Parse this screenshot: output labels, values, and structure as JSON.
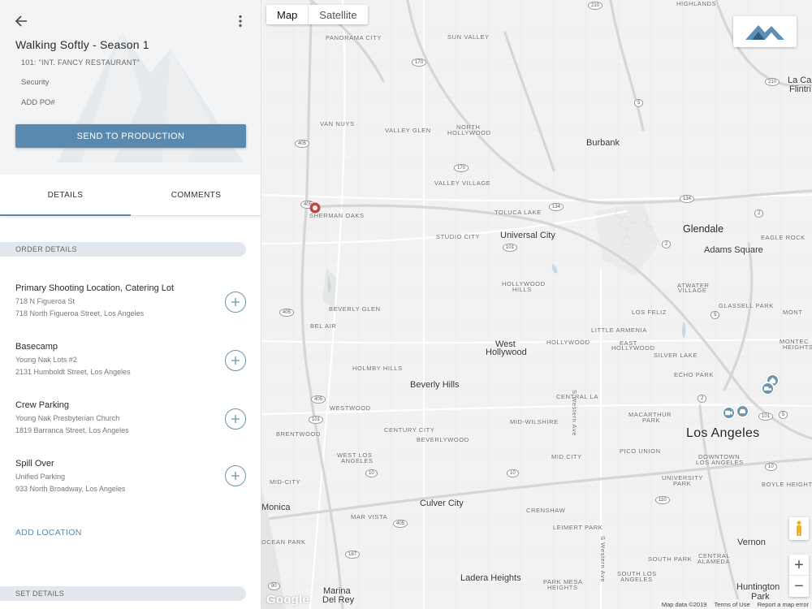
{
  "project": {
    "title": "Walking Softly - Season 1",
    "scene": "101: \"INT. FANCY RESTAURANT\"",
    "security": "Security",
    "add_po": "ADD PO#",
    "send_label": "SEND TO PRODUCTION"
  },
  "tabs": {
    "details": "DETAILS",
    "comments": "COMMENTS",
    "active": "details"
  },
  "sections": {
    "order_details": "ORDER DETAILS",
    "set_details": "SET DETAILS"
  },
  "locations": [
    {
      "name": "Primary Shooting Location, Catering Lot",
      "sub": "718 N Figueroa St",
      "address": "718 North Figueroa Street, Los Angeles"
    },
    {
      "name": "Basecamp",
      "sub": "Young Nak Lots #2",
      "address": "2131 Humboldt Street, Los Angeles"
    },
    {
      "name": "Crew Parking",
      "sub": "Young Nak Presbyterian Church",
      "address": "1819 Barranca Street, Los Angeles"
    },
    {
      "name": "Spill Over",
      "sub": "Unified Parking",
      "address": "933 North Broadway, Los Angeles"
    }
  ],
  "add_location": "ADD LOCATION",
  "map": {
    "map_type": {
      "map": "Map",
      "satellite": "Satellite",
      "selected": "Map"
    },
    "zoom_in": "+",
    "zoom_out": "−",
    "google": "Google",
    "footer": {
      "data": "Map data ©2019",
      "terms": "Terms of Use",
      "report": "Report a map error"
    },
    "labels": {
      "highlands": "HIGHLANDS",
      "panorama_city": "PANORAMA CITY",
      "sun_valley": "SUN VALLEY",
      "la_canada": "La Cañ",
      "flintridge": "Flintri",
      "van_nuys": "VAN NUYS",
      "valley_glen": "VALLEY GLEN",
      "north_hollywood_1": "NORTH",
      "north_hollywood_2": "HOLLYWOOD",
      "burbank": "Burbank",
      "valley_village": "VALLEY VILLAGE",
      "sherman_oaks": "SHERMAN OAKS",
      "toluca_lake": "TOLUCA LAKE",
      "studio_city": "STUDIO CITY",
      "universal_city": "Universal City",
      "glendale": "Glendale",
      "eagle_rock": "EAGLE ROCK",
      "adams_square": "Adams Square",
      "hollywood_hills_1": "HOLLYWOOD",
      "hollywood_hills_2": "HILLS",
      "atwater_1": "ATWATER",
      "atwater_2": "VILLAGE",
      "beverly_glen": "BEVERLY GLEN",
      "glassell_park": "GLASSELL PARK",
      "los_feliz": "LOS FELIZ",
      "mont_1": "MONT",
      "bel_air": "BEL AIR",
      "little_armenia": "LITTLE ARMENIA",
      "west_hollywood_1": "West",
      "west_hollywood_2": "Hollywood",
      "hollywood": "HOLLYWOOD",
      "east_hollywood_1": "EAST",
      "east_hollywood_2": "HOLLYWOOD",
      "silver_lake": "SILVER LAKE",
      "monte_1": "MONTEC",
      "monte_2": "HEIGHTS",
      "holmby_hills": "HOLMBY HILLS",
      "beverly_hills": "Beverly Hills",
      "echo_park": "ECHO PARK",
      "central_la": "CENTRAL LA",
      "macarthur_1": "MACARTHUR",
      "macarthur_2": "PARK",
      "westwood": "WESTWOOD",
      "mid_wilshire": "MID-WILSHIRE",
      "century_city": "CENTURY CITY",
      "brentwood": "BRENTWOOD",
      "beverlywood": "BEVERLYWOOD",
      "los_angeles": "Los Angeles",
      "west_la_1": "WEST LOS",
      "west_la_2": "ANGELES",
      "mid_city": "MID CITY",
      "pico_union": "PICO UNION",
      "downtown_1": "DOWNTOWN",
      "downtown_2": "LOS ANGELES",
      "mid_city_west": "MID-CITY",
      "university_park_1": "UNIVERSITY",
      "university_park_2": "PARK",
      "boyle_heights": "BOYLE HEIGHTS",
      "santa_monica": "Monica",
      "mar_vista": "MAR VISTA",
      "culver_city": "Culver City",
      "crenshaw": "CRENSHAW",
      "leimert_park": "LEIMERT PARK",
      "vernon": "Vernon",
      "ocean_park": "OCEAN PARK",
      "south_park": "SOUTH PARK",
      "central_alameda_1": "CENTRAL",
      "central_alameda_2": "ALAMEDA",
      "ladera_heights": "Ladera Heights",
      "park_mesa_1": "PARK MESA",
      "park_mesa_2": "HEIGHTS",
      "south_la_1": "SOUTH LOS",
      "south_la_2": "ANGELES",
      "huntington_1": "Huntington",
      "huntington_2": "Park",
      "marina_1": "Marina",
      "marina_2": "Del Rey",
      "s_western": "S Western Ave",
      "s_western_2": "S Western Ave",
      "route_210a": "210",
      "route_170a": "170",
      "route_170b": "170",
      "route_405a": "405",
      "route_5": "5",
      "route_134a": "134",
      "route_134b": "134",
      "route_2a": "2",
      "route_2b": "2",
      "route_210b": "210",
      "route_101a": "101",
      "route_101b": "101",
      "route_405b": "405",
      "route_405c": "405",
      "route_405d": "405",
      "route_10a": "10",
      "route_10b": "10",
      "route_110": "110",
      "route_187": "187",
      "route_90": "90",
      "route_405e": "405",
      "route_5b": "5",
      "route_2c": "2",
      "route_101c": "101",
      "route_5c": "5",
      "route_10c": "10"
    }
  }
}
